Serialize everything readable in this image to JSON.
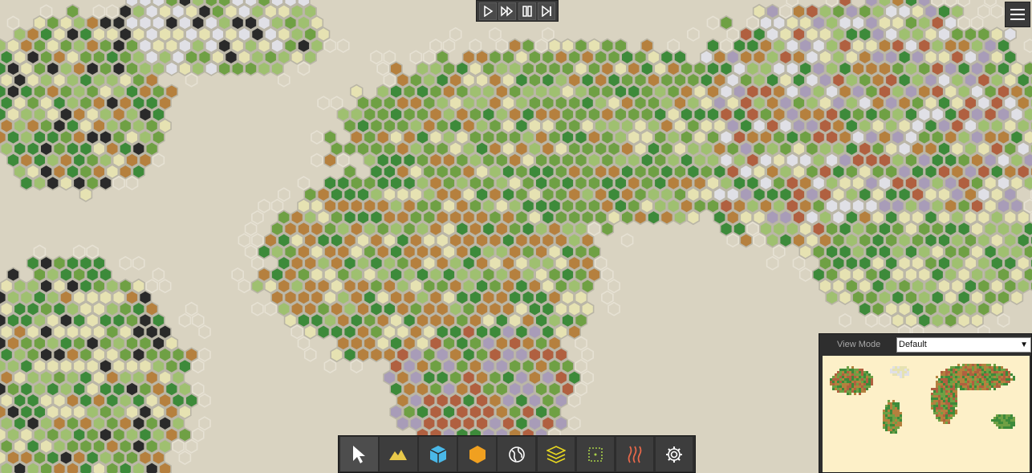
{
  "playback": {
    "play_icon": "play-icon",
    "fast_forward_icon": "fast-forward-icon",
    "pause_icon": "pause-icon",
    "step_icon": "step-forward-icon"
  },
  "menu": {
    "icon": "hamburger-menu-icon"
  },
  "toolbar": {
    "tools": [
      {
        "name": "select-tool",
        "icon": "cursor-icon",
        "color": "#ffffff"
      },
      {
        "name": "terrain-tool",
        "icon": "mountain-icon",
        "color": "#e8c84a"
      },
      {
        "name": "cube-tool",
        "icon": "cube-icon",
        "color": "#4ab8e8"
      },
      {
        "name": "hex-tool",
        "icon": "hexagon-icon",
        "color": "#f0a020"
      },
      {
        "name": "globe-tool",
        "icon": "globe-icon",
        "color": "#ffffff"
      },
      {
        "name": "layers-tool",
        "icon": "layers-icon",
        "color": "#e8d820"
      },
      {
        "name": "region-tool",
        "icon": "dotted-square-icon",
        "color": "#a8d048"
      },
      {
        "name": "heat-tool",
        "icon": "heat-waves-icon",
        "color": "#e8684a"
      },
      {
        "name": "settings-tool",
        "icon": "gear-icon",
        "color": "#ffffff"
      }
    ]
  },
  "view_panel": {
    "label": "View Mode",
    "selected": "Default"
  },
  "colors": {
    "background": "#d9d3c1",
    "grass": "#6fa044",
    "forest": "#3d8a3a",
    "light_grass": "#9fc070",
    "sand": "#e6e2b2",
    "dirt": "#b5803e",
    "red_dirt": "#b06040",
    "snow": "#e0e0e6",
    "rock": "#2a2a2a",
    "purple": "#a89cb8"
  }
}
